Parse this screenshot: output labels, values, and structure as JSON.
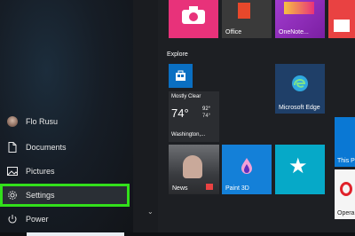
{
  "start_menu": {
    "left": {
      "user_name": "Flo Rusu",
      "items": [
        {
          "label": "Documents",
          "icon": "document-icon"
        },
        {
          "label": "Pictures",
          "icon": "pictures-icon"
        },
        {
          "label": "Settings",
          "icon": "gear-icon"
        },
        {
          "label": "Power",
          "icon": "power-icon"
        }
      ]
    },
    "tiles": {
      "top_row": [
        {
          "label": "",
          "icon": "camera-icon",
          "color": "#e8327a"
        },
        {
          "label": "Office",
          "icon": "office-icon",
          "color": "#3a3a3a"
        },
        {
          "label": "OneNote...",
          "icon": "onenote-icon",
          "color": "#a23ccf"
        },
        {
          "label": "",
          "icon": "store-bag-icon",
          "color": "#e94242"
        }
      ],
      "section_explore": "Explore",
      "store_tile": {
        "label": "",
        "icon": "store-icon",
        "color": "#0a6fc2"
      },
      "weather": {
        "condition": "Mostly Clear",
        "temp": "74°",
        "high": "92°",
        "low": "74°",
        "location": "Washington,..."
      },
      "edge": {
        "label": "Microsoft Edge",
        "icon": "edge-icon",
        "color": "#1f3f68"
      },
      "news": {
        "label": "News",
        "icon": "news-icon"
      },
      "paint3d": {
        "label": "Paint 3D",
        "icon": "paint3d-icon",
        "color": "#1480d8"
      },
      "star_tile": {
        "label": "",
        "icon": "star-icon",
        "color": "#06a9c8"
      },
      "right_partial_1": {
        "label": "This P",
        "color": "#0a78d4"
      },
      "right_partial_2": {
        "label": "Opera",
        "color": "#f5f5f5"
      }
    }
  }
}
